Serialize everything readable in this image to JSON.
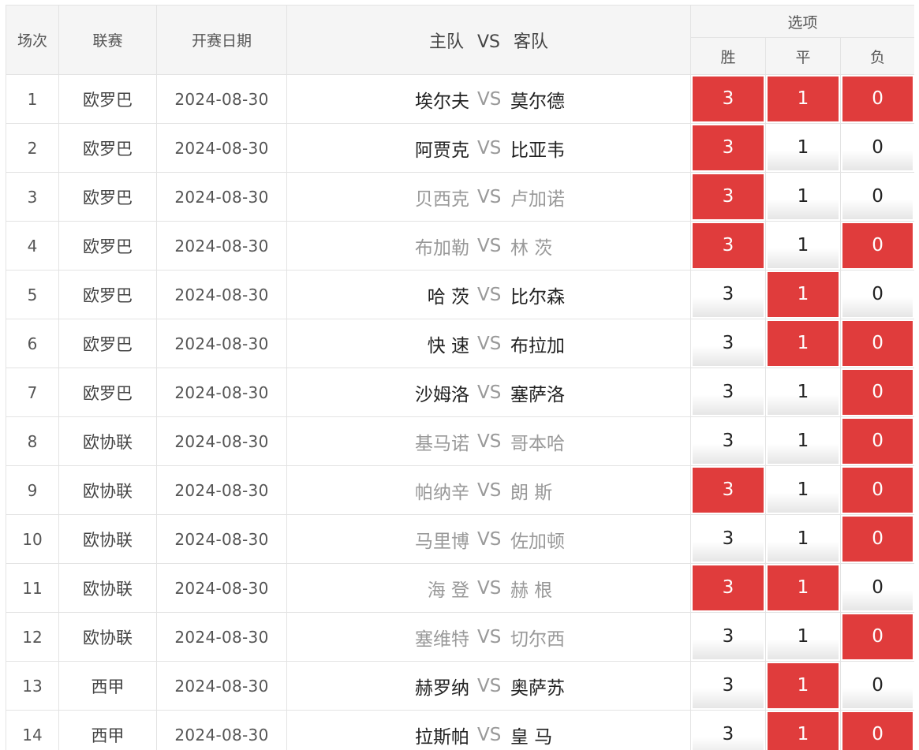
{
  "header": {
    "col_round": "场次",
    "col_league": "联赛",
    "col_date": "开赛日期",
    "col_home": "主队",
    "col_vs": "VS",
    "col_away": "客队",
    "col_options": "选项",
    "opt_win": "胜",
    "opt_draw": "平",
    "opt_lose": "负"
  },
  "colors": {
    "selected": "#e03c3c",
    "header_bg": "#f5f5f5",
    "border": "#e3e3e3",
    "team_dark": "#222222",
    "team_light": "#999999"
  },
  "rows": [
    {
      "no": "1",
      "league": "欧罗巴",
      "date": "2024-08-30",
      "home": "埃尔夫",
      "vs": "VS",
      "away": "莫尔德",
      "dim": false,
      "win": "3",
      "draw": "1",
      "lose": "0",
      "sel": [
        true,
        true,
        true
      ]
    },
    {
      "no": "2",
      "league": "欧罗巴",
      "date": "2024-08-30",
      "home": "阿贾克",
      "vs": "VS",
      "away": "比亚韦",
      "dim": false,
      "win": "3",
      "draw": "1",
      "lose": "0",
      "sel": [
        true,
        false,
        false
      ]
    },
    {
      "no": "3",
      "league": "欧罗巴",
      "date": "2024-08-30",
      "home": "贝西克",
      "vs": "VS",
      "away": "卢加诺",
      "dim": true,
      "win": "3",
      "draw": "1",
      "lose": "0",
      "sel": [
        true,
        false,
        false
      ]
    },
    {
      "no": "4",
      "league": "欧罗巴",
      "date": "2024-08-30",
      "home": "布加勒",
      "vs": "VS",
      "away": "林 茨",
      "dim": true,
      "win": "3",
      "draw": "1",
      "lose": "0",
      "sel": [
        true,
        false,
        true
      ]
    },
    {
      "no": "5",
      "league": "欧罗巴",
      "date": "2024-08-30",
      "home": "哈 茨",
      "vs": "VS",
      "away": "比尔森",
      "dim": false,
      "win": "3",
      "draw": "1",
      "lose": "0",
      "sel": [
        false,
        true,
        false
      ]
    },
    {
      "no": "6",
      "league": "欧罗巴",
      "date": "2024-08-30",
      "home": "快 速",
      "vs": "VS",
      "away": "布拉加",
      "dim": false,
      "win": "3",
      "draw": "1",
      "lose": "0",
      "sel": [
        false,
        true,
        true
      ]
    },
    {
      "no": "7",
      "league": "欧罗巴",
      "date": "2024-08-30",
      "home": "沙姆洛",
      "vs": "VS",
      "away": "塞萨洛",
      "dim": false,
      "win": "3",
      "draw": "1",
      "lose": "0",
      "sel": [
        false,
        false,
        true
      ]
    },
    {
      "no": "8",
      "league": "欧协联",
      "date": "2024-08-30",
      "home": "基马诺",
      "vs": "VS",
      "away": "哥本哈",
      "dim": true,
      "win": "3",
      "draw": "1",
      "lose": "0",
      "sel": [
        false,
        false,
        true
      ]
    },
    {
      "no": "9",
      "league": "欧协联",
      "date": "2024-08-30",
      "home": "帕纳辛",
      "vs": "VS",
      "away": "朗 斯",
      "dim": true,
      "win": "3",
      "draw": "1",
      "lose": "0",
      "sel": [
        true,
        false,
        true
      ]
    },
    {
      "no": "10",
      "league": "欧协联",
      "date": "2024-08-30",
      "home": "马里博",
      "vs": "VS",
      "away": "佐加顿",
      "dim": true,
      "win": "3",
      "draw": "1",
      "lose": "0",
      "sel": [
        false,
        false,
        true
      ]
    },
    {
      "no": "11",
      "league": "欧协联",
      "date": "2024-08-30",
      "home": "海 登",
      "vs": "VS",
      "away": "赫 根",
      "dim": true,
      "win": "3",
      "draw": "1",
      "lose": "0",
      "sel": [
        true,
        true,
        false
      ]
    },
    {
      "no": "12",
      "league": "欧协联",
      "date": "2024-08-30",
      "home": "塞维特",
      "vs": "VS",
      "away": "切尔西",
      "dim": true,
      "win": "3",
      "draw": "1",
      "lose": "0",
      "sel": [
        false,
        false,
        true
      ]
    },
    {
      "no": "13",
      "league": "西甲",
      "date": "2024-08-30",
      "home": "赫罗纳",
      "vs": "VS",
      "away": "奥萨苏",
      "dim": false,
      "win": "3",
      "draw": "1",
      "lose": "0",
      "sel": [
        false,
        true,
        false
      ]
    },
    {
      "no": "14",
      "league": "西甲",
      "date": "2024-08-30",
      "home": "拉斯帕",
      "vs": "VS",
      "away": "皇 马",
      "dim": false,
      "win": "3",
      "draw": "1",
      "lose": "0",
      "sel": [
        false,
        true,
        true
      ]
    }
  ]
}
